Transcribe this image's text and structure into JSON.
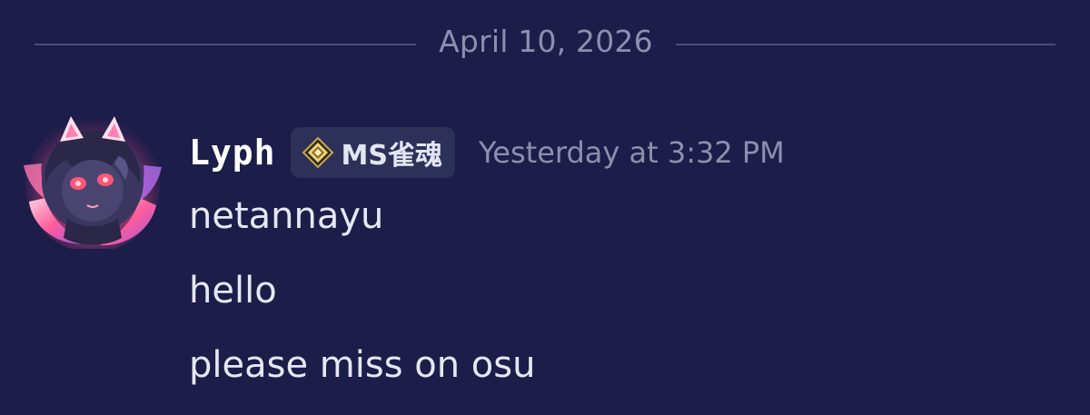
{
  "divider": {
    "date": "April 10, 2026"
  },
  "message": {
    "username": "Lyph",
    "tag": {
      "label": "MS雀魂",
      "icon": "diamond-star-icon"
    },
    "timestamp": "Yesterday at 3:32 PM",
    "avatar": "anime-fox-girl-avatar",
    "lines": [
      "netannayu",
      "hello",
      "please miss on osu"
    ]
  },
  "colors": {
    "background": "#1c1d49",
    "muted_text": "#8d8fae",
    "username": "#ffffff",
    "message_text": "#e6e7f3",
    "tag_background": "#2d3059"
  }
}
